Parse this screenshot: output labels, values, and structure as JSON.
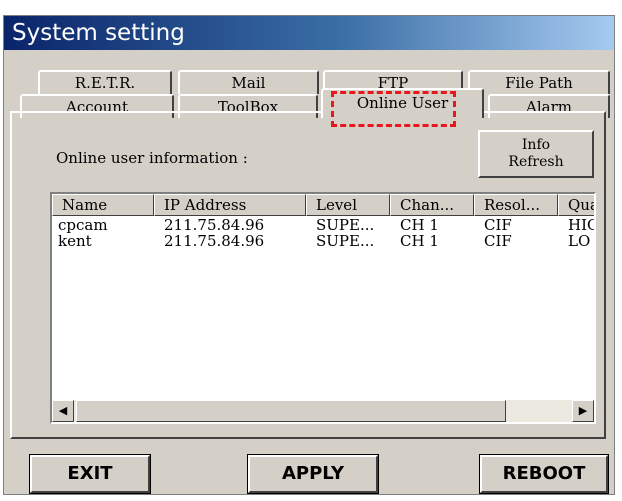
{
  "window": {
    "title": "System setting"
  },
  "tabs_row1": [
    "R.E.T.R.",
    "Mail",
    "FTP",
    "File Path"
  ],
  "tabs_row2": [
    "Account",
    "ToolBox",
    "Online User",
    "Alarm"
  ],
  "active_tab": "Online User",
  "panel": {
    "info_label": "Online user information :",
    "refresh_button": {
      "line1": "Info",
      "line2": "Refresh"
    }
  },
  "table": {
    "columns": [
      "Name",
      "IP Address",
      "Level",
      "Chan...",
      "Resol...",
      "Qua"
    ],
    "rows": [
      [
        "cpcam",
        "211.75.84.96",
        "SUPE...",
        "CH 1",
        "CIF",
        "HIG"
      ],
      [
        "kent",
        "211.75.84.96",
        "SUPE...",
        "CH 1",
        "CIF",
        "LO"
      ]
    ]
  },
  "scrollbar": {
    "left_arrow": "◀",
    "right_arrow": "▶"
  },
  "buttons": {
    "exit": "EXIT",
    "apply": "APPLY",
    "reboot": "REBOOT"
  },
  "colors": {
    "highlight": "#e8161d",
    "title_start": "#0a246a",
    "title_end": "#a6caf0",
    "face": "#d4d0c8"
  }
}
